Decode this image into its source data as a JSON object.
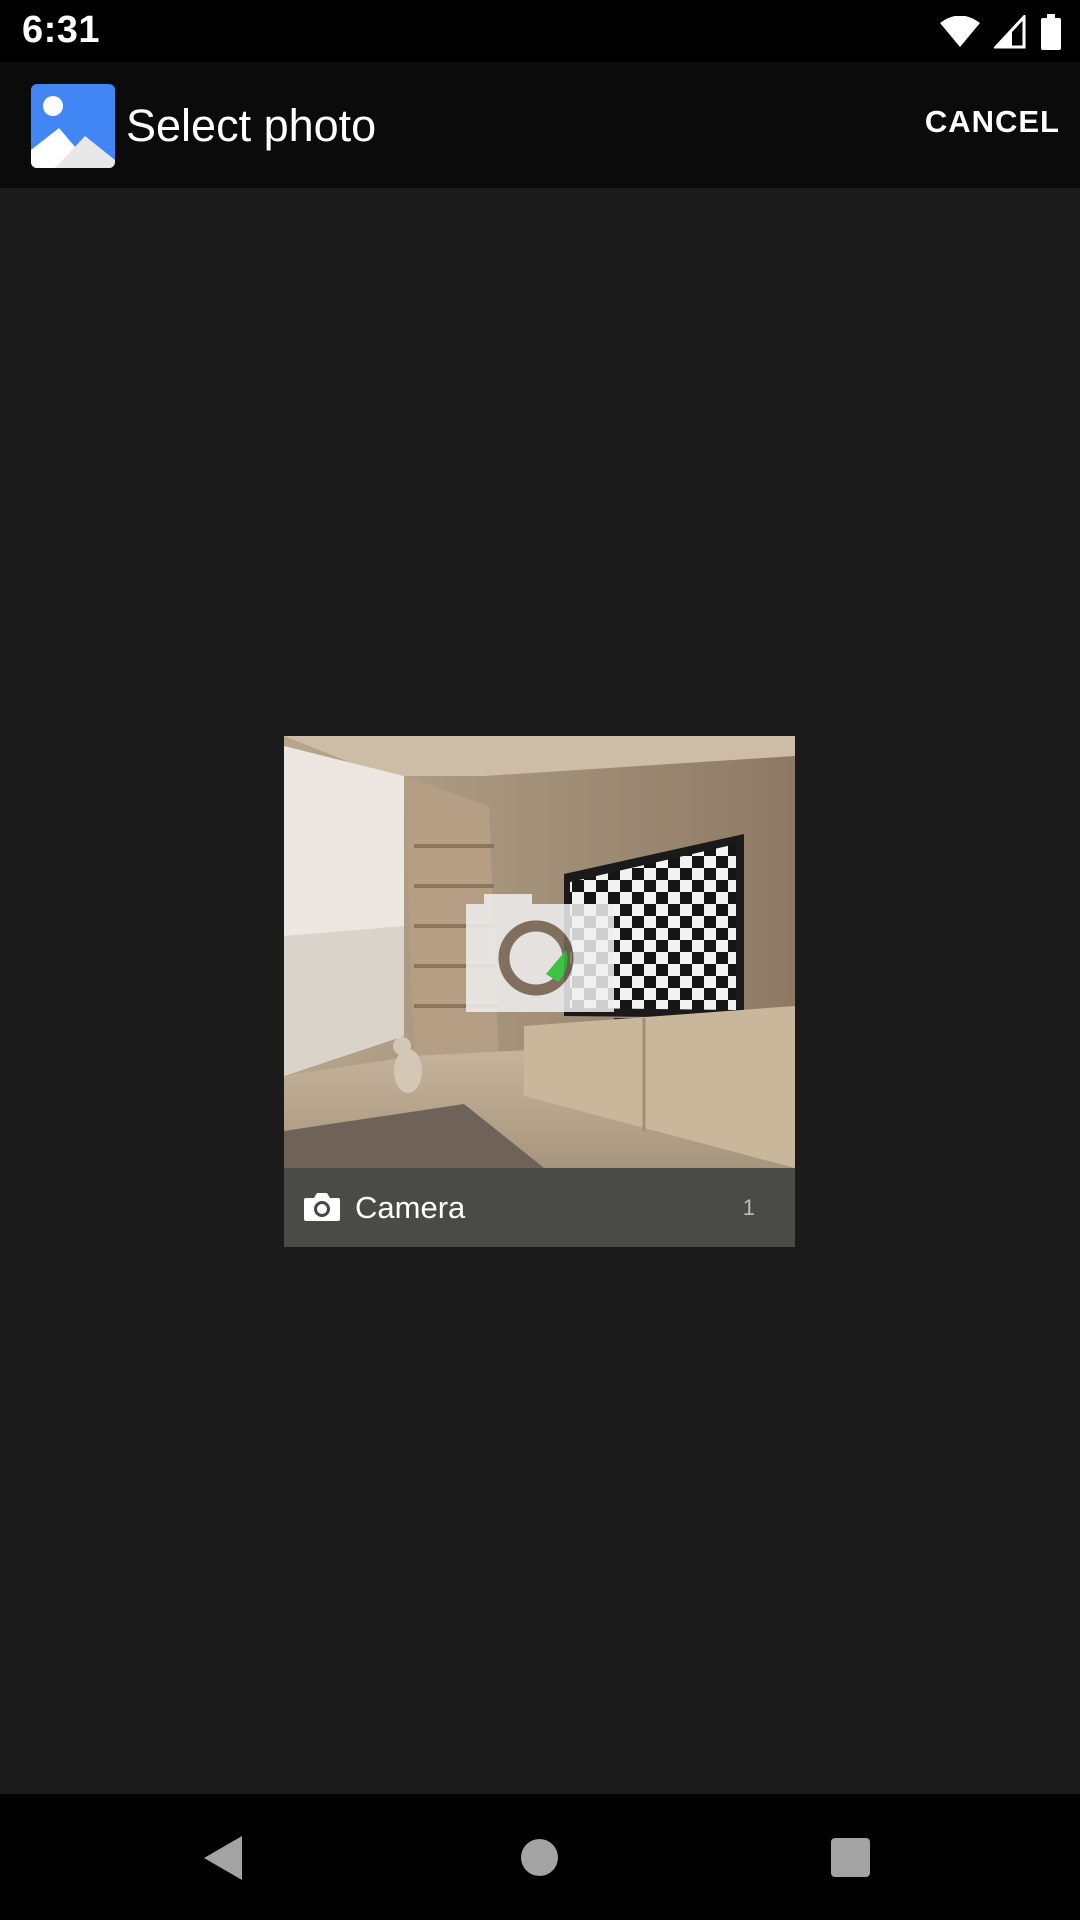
{
  "status_bar": {
    "time": "6:31",
    "icons": [
      "wifi-icon",
      "cell-signal-icon",
      "battery-icon"
    ]
  },
  "app_bar": {
    "icon": "photos-app-icon",
    "title": "Select photo",
    "cancel_label": "CANCEL"
  },
  "albums": [
    {
      "icon": "camera-icon",
      "name": "Camera",
      "count": "1"
    }
  ],
  "nav_bar": {
    "buttons": [
      "back",
      "home",
      "recents"
    ]
  },
  "colors": {
    "background": "#1b1b1b",
    "app_bar": "#0b0b0b",
    "status_bar": "#000000",
    "app_icon_blue": "#4285f4",
    "album_footer": "#464646"
  }
}
